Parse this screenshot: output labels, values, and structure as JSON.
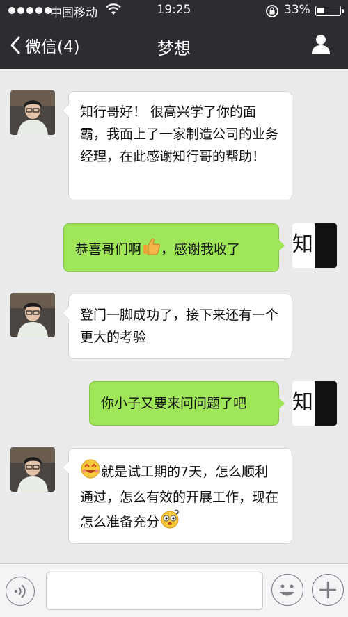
{
  "status_bar": {
    "carrier": "中国移动",
    "time": "19:25",
    "battery_percent_text": "33%",
    "battery_level": 0.33
  },
  "nav": {
    "back_label": "微信(4)",
    "title": "梦想"
  },
  "messages": [
    {
      "side": "left",
      "text": "知行哥好！ 很高兴学了你的面霸，我面上了一家制造公司的业务经理，在此感谢知行哥的帮助！"
    },
    {
      "side": "right",
      "text_before": "恭喜哥们啊",
      "emoji": "thumbs-up-emoji",
      "text_after": "，感谢我收了"
    },
    {
      "side": "left",
      "text": "登门一脚成功了，接下来还有一个更大的考验"
    },
    {
      "side": "right",
      "text": "你小子又要来问问题了吧"
    },
    {
      "side": "left",
      "lead_emoji": "happy-face-emoji",
      "text": "就是试工期的7天，怎么顺利通过，怎么有效的开展工作，现在怎么准备充分",
      "tail_emoji": "confused-face-emoji"
    }
  ],
  "logo_text": "知行",
  "colors": {
    "nav_background": "#2b2d31",
    "chat_background": "#ebebeb",
    "sent_bubble": "#9fe659",
    "received_bubble": "#ffffff"
  },
  "input_bar": {
    "placeholder": ""
  }
}
